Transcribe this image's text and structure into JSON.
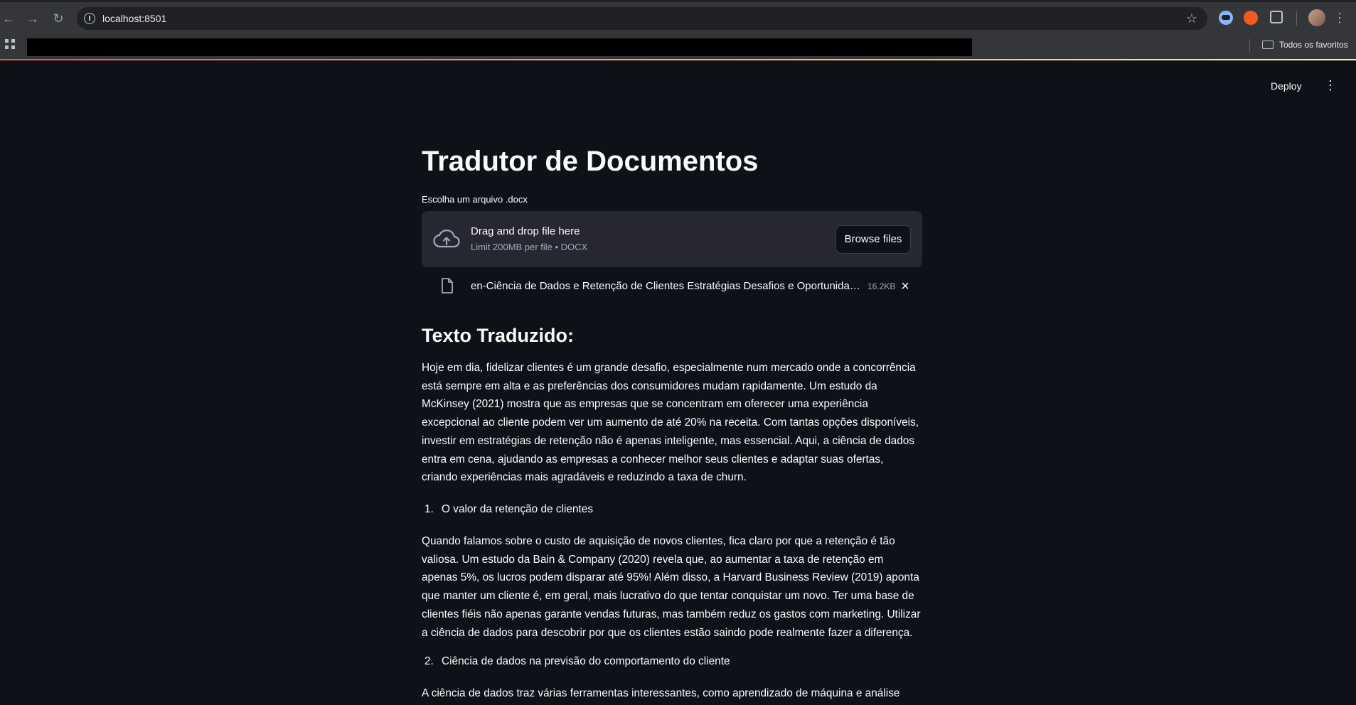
{
  "browser": {
    "url": "localhost:8501",
    "bookmarks_folder": "Todos os favoritos"
  },
  "app": {
    "deploy_label": "Deploy",
    "title": "Tradutor de Documentos",
    "uploader": {
      "label": "Escolha um arquivo .docx",
      "drag_text": "Drag and drop file here",
      "limit_text": "Limit 200MB per file • DOCX",
      "browse_label": "Browse files"
    },
    "uploaded_file": {
      "name": "en-Ciência de Dados e Retenção de Clientes Estratégias Desafios e Oportunidades.docx",
      "size": "16.2KB"
    },
    "subheader": "Texto Traduzido:",
    "paragraphs": [
      "Hoje em dia, fidelizar clientes é um grande desafio, especialmente num mercado onde a concorrência está sempre em alta e as preferências dos consumidores mudam rapidamente. Um estudo da McKinsey (2021) mostra que as empresas que se concentram em oferecer uma experiência excepcional ao cliente podem ver um aumento de até 20% na receita. Com tantas opções disponíveis, investir em estratégias de retenção não é apenas inteligente, mas essencial. Aqui, a ciência de dados entra em cena, ajudando as empresas a conhecer melhor seus clientes e adaptar suas ofertas, criando experiências mais agradáveis e reduzindo a taxa de churn.",
      "Quando falamos sobre o custo de aquisição de novos clientes, fica claro por que a retenção é tão valiosa. Um estudo da Bain & Company (2020) revela que, ao aumentar a taxa de retenção em apenas 5%, os lucros podem disparar até 95%! Além disso, a Harvard Business Review (2019) aponta que manter um cliente é, em geral, mais lucrativo do que tentar conquistar um novo. Ter uma base de clientes fiéis não apenas garante vendas futuras, mas também reduz os gastos com marketing. Utilizar a ciência de dados para descobrir por que os clientes estão saindo pode realmente fazer a diferença.",
      "A ciência de dados traz várias ferramentas interessantes, como aprendizado de máquina e análise"
    ],
    "list_items": [
      {
        "number": "1.",
        "text": "O valor da retenção de clientes"
      },
      {
        "number": "2.",
        "text": "Ciência de dados na previsão do comportamento do cliente"
      }
    ]
  }
}
